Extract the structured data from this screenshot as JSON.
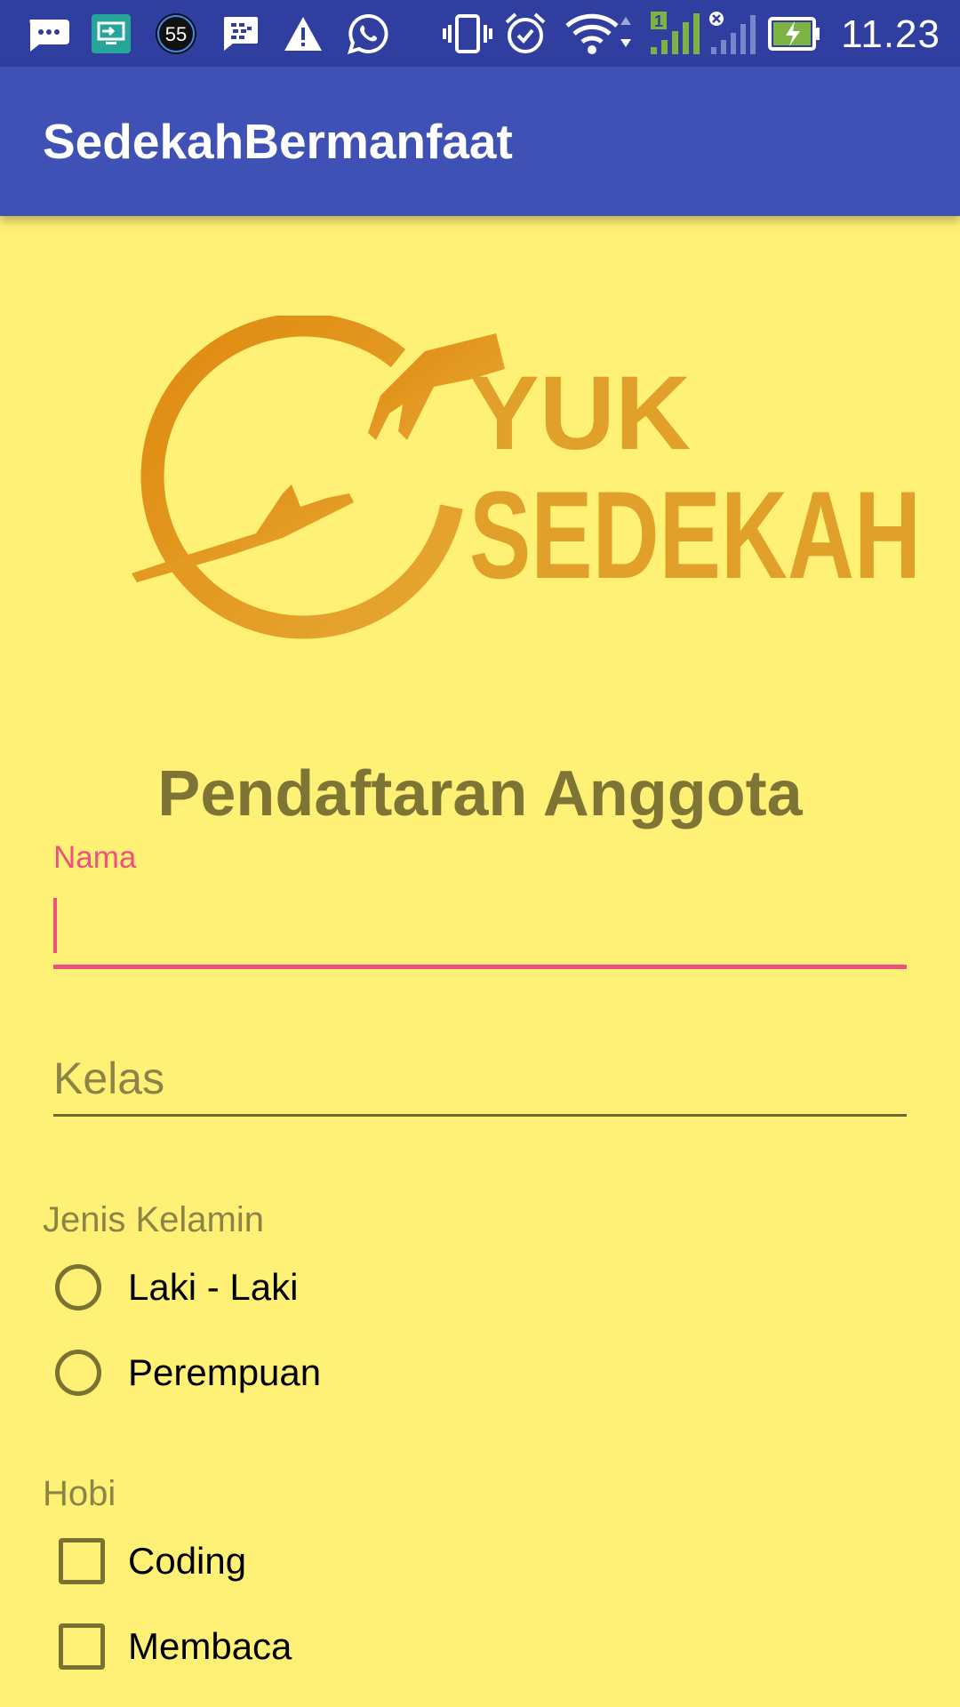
{
  "status_bar": {
    "time": "11.23",
    "notification_badge": "55",
    "sim_slot": "1",
    "icons": [
      "chat-bubble-icon",
      "screen-cast-icon",
      "badge-icon",
      "bbm-icon",
      "warning-icon",
      "whatsapp-icon",
      "vibrate-icon",
      "alarm-icon",
      "wifi-icon",
      "signal-icon",
      "signal-off-icon",
      "battery-charging-icon"
    ]
  },
  "app_bar": {
    "title": "SedekahBermanfaat"
  },
  "logo": {
    "line1": "YUK",
    "line2": "SEDEKAH",
    "color": "#E0A02A"
  },
  "form": {
    "heading": "Pendaftaran Anggota",
    "name_label": "Nama",
    "name_value": "",
    "kelas_placeholder": "Kelas",
    "gender_label": "Jenis Kelamin",
    "gender_options": [
      "Laki - Laki",
      "Perempuan"
    ],
    "hobby_label": "Hobi",
    "hobby_options": [
      "Coding",
      "Membaca"
    ]
  },
  "colors": {
    "status_bar": "#303F9F",
    "app_bar": "#3F51B5",
    "background": "#FFF176",
    "accent": "#F0507E",
    "heading": "#7D7435"
  }
}
